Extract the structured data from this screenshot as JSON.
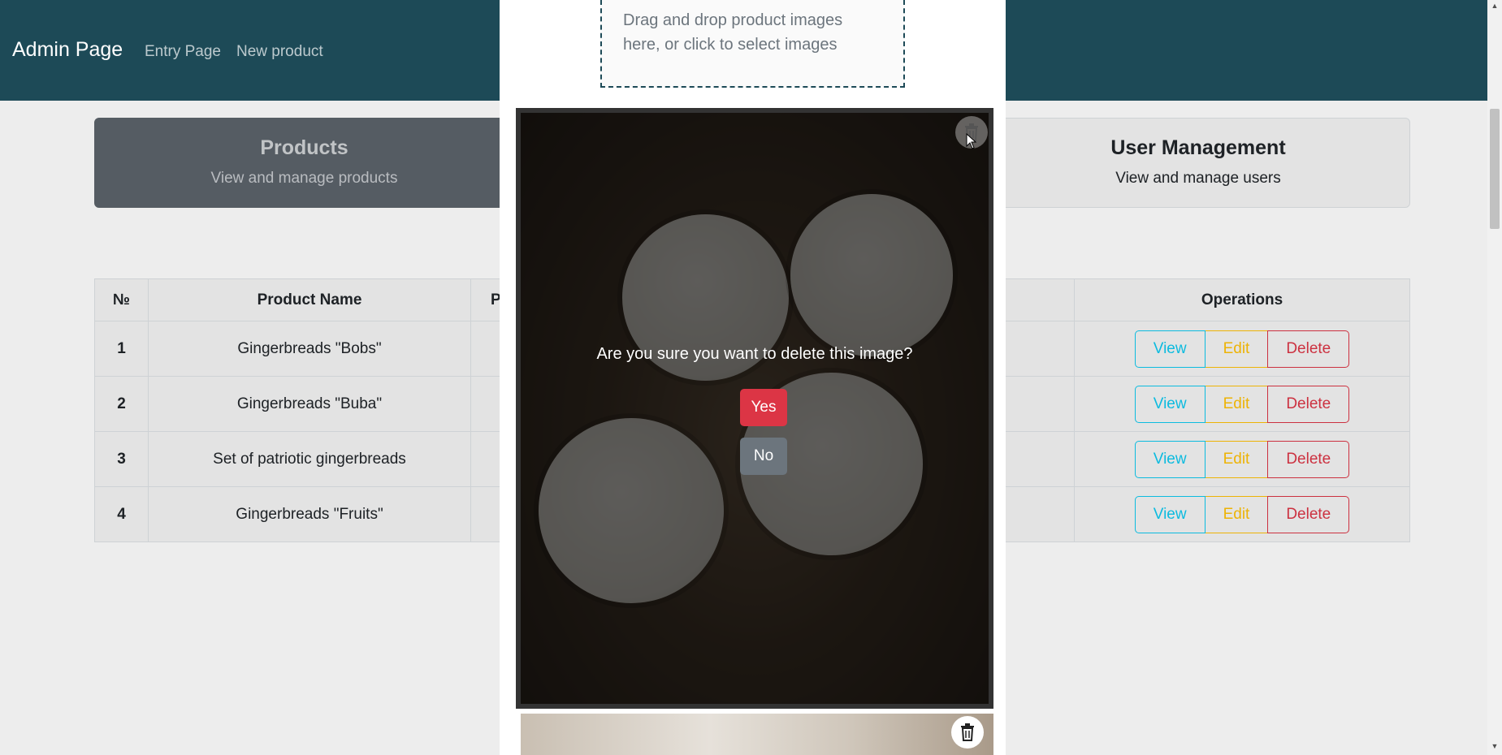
{
  "navbar": {
    "brand": "Admin Page",
    "links": [
      "Entry Page",
      "New product"
    ]
  },
  "tiles": [
    {
      "title": "Products",
      "subtitle": "View and manage products",
      "active": true
    },
    {
      "title": "User Management",
      "subtitle": "View and manage users",
      "active": false
    }
  ],
  "table": {
    "headers": [
      "№",
      "Product Name",
      "P",
      "Operations"
    ],
    "rows": [
      {
        "num": "1",
        "name": "Gingerbreads \"Bobs\""
      },
      {
        "num": "2",
        "name": "Gingerbreads \"Buba\""
      },
      {
        "num": "3",
        "name": "Set of patriotic gingerbreads"
      },
      {
        "num": "4",
        "name": "Gingerbreads \"Fruits\""
      }
    ],
    "operations": {
      "view": "View",
      "edit": "Edit",
      "delete": "Delete"
    }
  },
  "modal": {
    "dropzone_text": "Drag and drop product images here, or click to select images",
    "confirm_text": "Are you sure you want to delete this image?",
    "yes_label": "Yes",
    "no_label": "No"
  },
  "colors": {
    "navbar": "#1d4a57",
    "danger": "#dc3545",
    "secondary": "#6c757d",
    "info": "#0dcaf0",
    "warning": "#ffc107"
  },
  "icons": [
    "trash-icon",
    "mouse-cursor-icon"
  ]
}
